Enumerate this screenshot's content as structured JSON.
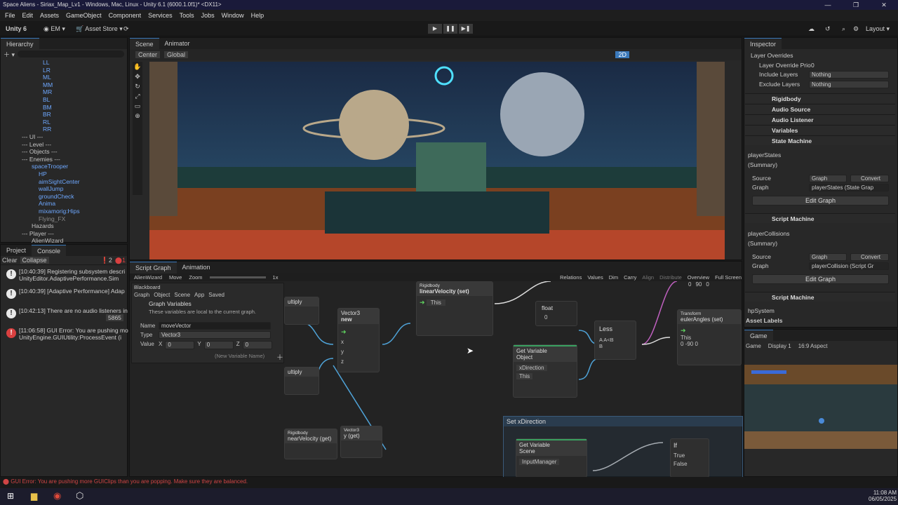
{
  "window": {
    "title": "Space Aliens - Siriax_Map_Lv1 - Windows, Mac, Linux - Unity 6.1 (6000.1.0f1)* <DX11>"
  },
  "menu": [
    "File",
    "Edit",
    "Assets",
    "GameObject",
    "Component",
    "Services",
    "Tools",
    "Jobs",
    "Window",
    "Help"
  ],
  "toolbar": {
    "unity": "Unity 6",
    "account": "EM",
    "asset_store": "Asset Store",
    "layout": "Layout"
  },
  "hierarchy": {
    "title": "Hierarchy",
    "items": [
      "LL",
      "LR",
      "ML",
      "MM",
      "MR",
      "BL",
      "BM",
      "BR",
      "RL",
      "RR",
      "--- UI ---",
      "--- Level ---",
      "--- Objects ---",
      "--- Enemies ---",
      "spaceTrooper",
      "HP",
      "aimSightCenter",
      "wallJump",
      "groundCheck",
      "Anima",
      "mixamorig:Hips",
      "Flying_FX",
      "Hazards",
      "--- Player ---",
      "AlienWizard"
    ]
  },
  "console": {
    "tabs": [
      "Project",
      "Console"
    ],
    "clear": "Clear",
    "collapse": "Collapse",
    "counts": {
      "warn": "2",
      "err": "1"
    },
    "rows": [
      {
        "time": "[10:40:39] Registering subsystem descri",
        "detail": "UnityEditor.AdaptivePerformance.Sim"
      },
      {
        "time": "[10:40:39] [Adaptive Performance] Adap",
        "detail": ""
      },
      {
        "time": "[10:42:13] There are no audio listeners in",
        "detail": "5865"
      },
      {
        "time": "[11:06:58] GUI Error: You are pushing mo",
        "detail": "UnityEngine.GUIUtility:ProcessEvent (i"
      }
    ]
  },
  "scene": {
    "tabs": [
      "Scene",
      "Animator"
    ],
    "pivot": "Center",
    "space": "Global",
    "mode2d": "2D"
  },
  "graph": {
    "tabs": [
      "Script Graph",
      "Animation"
    ],
    "breadcrumb": "AlienWizard",
    "move": "Move",
    "zoom": "Zoom",
    "zoom_val": "1x",
    "toolbar": [
      "Relations",
      "Values",
      "Dim",
      "Carry",
      "Align",
      "Distribute",
      "Overview",
      "Full Screen"
    ],
    "blackboard": {
      "title": "Blackboard",
      "tabs": [
        "Graph",
        "Object",
        "Scene",
        "App",
        "Saved"
      ],
      "heading": "Graph Variables",
      "desc": "These variables are local to the current graph.",
      "name_label": "Name",
      "name": "moveVector",
      "type_label": "Type",
      "type": "Vector3",
      "value_label": "Value",
      "x": "0",
      "y": "0",
      "z": "0",
      "new_var": "(New Variable Name)"
    },
    "nodes": {
      "vec3new_title": "Vector3",
      "vec3new_sub": "new",
      "rb_title": "Rigidbody",
      "rb_sub": "linearVelocity (set)",
      "float_title": "float",
      "float_val": "0",
      "less": "Less",
      "getvar_title": "Get Variable",
      "getvar_kind": "Object",
      "getvar_name": "xDirection",
      "getvar_this": "This",
      "transform_title": "Transform",
      "transform_sub": "eulerAngles (set)",
      "transform_vals": [
        "0",
        "-90",
        "0"
      ],
      "top_vals": [
        "0",
        "90",
        "0"
      ],
      "set_xdir": "Set xDirection",
      "getvar2_title": "Get Variable",
      "getvar2_kind": "Scene",
      "getvar2_name": "InputManager",
      "if": "If",
      "true": "True",
      "false": "False",
      "vec3get_title": "Vector3",
      "vec3get_sub": "y (get)",
      "rb2_title": "Rigidbody",
      "rb2_sub": "nearVelocity (get)",
      "mult1": "ultiply",
      "mult2": "ultiply",
      "this": "This"
    }
  },
  "inspector": {
    "title": "Inspector",
    "layer_overrides": "Layer Overrides",
    "priority_label": "Layer Override Prio",
    "priority": "0",
    "include_label": "Include Layers",
    "include": "Nothing",
    "exclude_label": "Exclude Layers",
    "exclude": "Nothing",
    "components": [
      "Rigidbody",
      "Audio Source",
      "Audio Listener",
      "Variables",
      "State Machine"
    ],
    "sm1": {
      "name": "playerStates",
      "summary": "(Summary)",
      "source_label": "Source",
      "source": "Graph",
      "convert": "Convert",
      "graph_label": "Graph",
      "graph": "playerStates (State Grap",
      "edit": "Edit Graph"
    },
    "script_machine": "Script Machine",
    "sm2": {
      "name": "playerCollisions",
      "summary": "(Summary)",
      "source_label": "Source",
      "source": "Graph",
      "convert": "Convert",
      "graph_label": "Graph",
      "graph": "playerCollision (Script Gr",
      "edit": "Edit Graph"
    },
    "script_machine2": "Script Machine",
    "next": "hpSystem",
    "asset_labels": "Asset Labels"
  },
  "game": {
    "tab": "Game",
    "mode": "Game",
    "display": "Display 1",
    "aspect": "16:9 Aspect"
  },
  "status": {
    "error": "GUI Error: You are pushing more GUIClips than you are popping. Make sure they are balanced."
  },
  "taskbar": {
    "time": "11:08 AM",
    "date": "06/05/2025"
  }
}
